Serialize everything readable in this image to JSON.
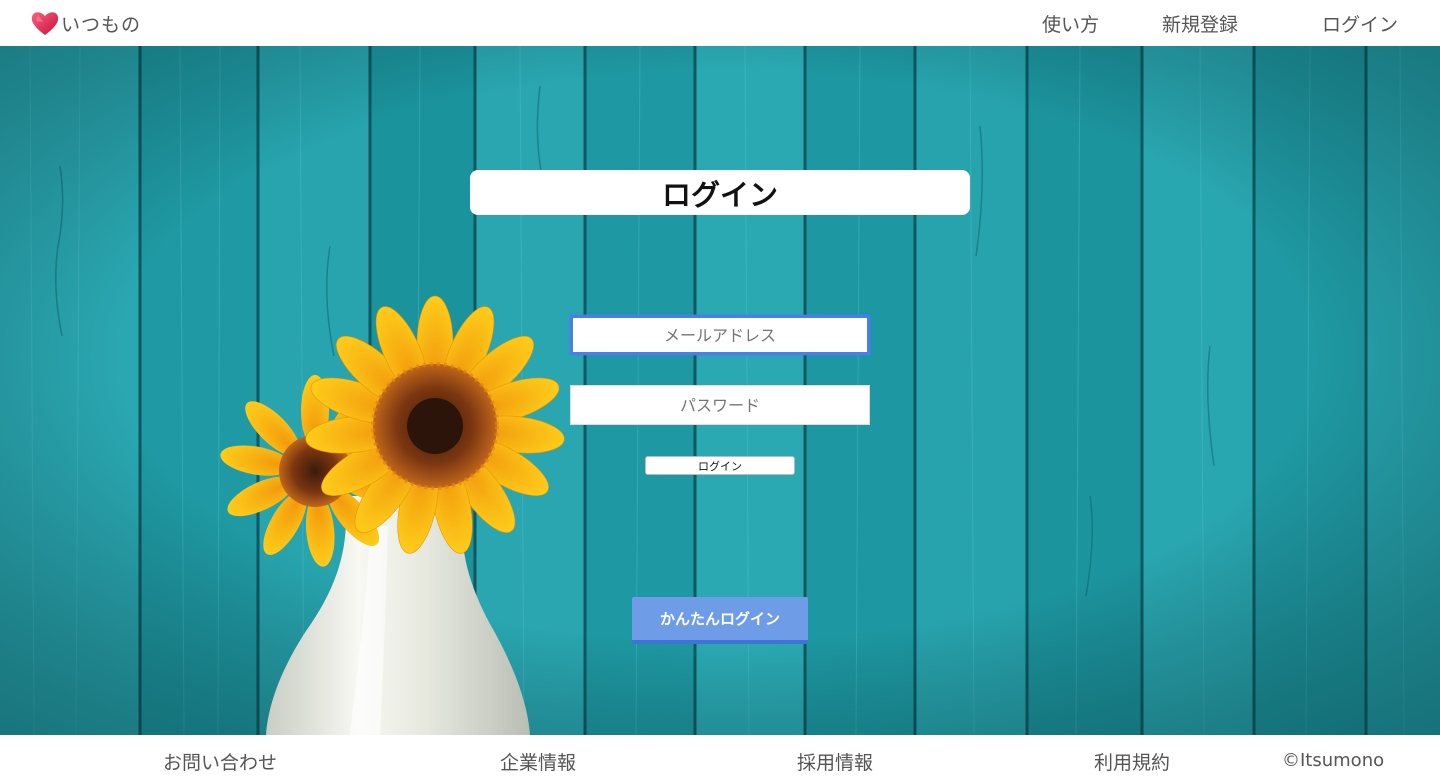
{
  "header": {
    "logo_text": "いつもの",
    "nav": [
      "使い方",
      "新規登録",
      "ログイン"
    ]
  },
  "login": {
    "title": "ログイン",
    "email_placeholder": "メールアドレス",
    "password_placeholder": "パスワード",
    "submit_label": "ログイン",
    "easy_login_label": "かんたんログイン"
  },
  "footer": {
    "links": [
      "お問い合わせ",
      "企業情報",
      "採用情報",
      "利用規約"
    ],
    "copyright": "©Itsumono"
  },
  "colors": {
    "background": "#1d95a0",
    "accent_button": "#6f9ce6",
    "logo_heart": "#e0214f"
  }
}
